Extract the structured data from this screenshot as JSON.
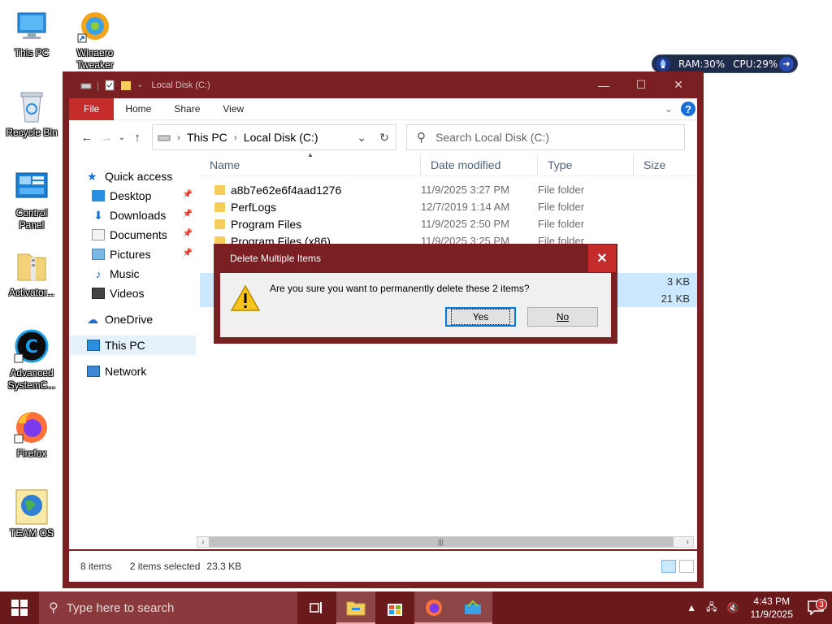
{
  "desktop": {
    "icons": [
      {
        "label": "This PC"
      },
      {
        "label": "Winaero\nTweaker"
      },
      {
        "label": "Recycle Bin"
      },
      {
        "label": "Control\nPanel"
      },
      {
        "label": "Activator..."
      },
      {
        "label": "Advanced\nSystemC..."
      },
      {
        "label": "Firefox"
      },
      {
        "label": "TEAM OS"
      }
    ]
  },
  "perf_widget": {
    "ram": "RAM:30%",
    "cpu": "CPU:29%"
  },
  "explorer": {
    "title": "Local Disk (C:)",
    "ribbon_tabs": [
      "File",
      "Home",
      "Share",
      "View"
    ],
    "address": {
      "segments": [
        "This PC",
        "Local Disk (C:)"
      ]
    },
    "search_placeholder": "Search Local Disk (C:)",
    "nav_items": [
      {
        "label": "Quick access",
        "icon": "star-icon"
      },
      {
        "label": "Desktop",
        "icon": "desktop-icon"
      },
      {
        "label": "Downloads",
        "icon": "download-icon"
      },
      {
        "label": "Documents",
        "icon": "documents-icon"
      },
      {
        "label": "Pictures",
        "icon": "pictures-icon"
      },
      {
        "label": "Music",
        "icon": "music-icon"
      },
      {
        "label": "Videos",
        "icon": "videos-icon"
      },
      {
        "label": "OneDrive",
        "icon": "cloud-icon"
      },
      {
        "label": "This PC",
        "icon": "computer-icon"
      },
      {
        "label": "Network",
        "icon": "network-icon"
      }
    ],
    "columns": [
      "Name",
      "Date modified",
      "Type",
      "Size"
    ],
    "rows": [
      {
        "name": "a8b7e62e6f4aad1276",
        "date": "11/9/2025 3:27 PM",
        "type": "File folder",
        "size": ""
      },
      {
        "name": "PerfLogs",
        "date": "12/7/2019 1:14 AM",
        "type": "File folder",
        "size": ""
      },
      {
        "name": "Program Files",
        "date": "11/9/2025 2:50 PM",
        "type": "File folder",
        "size": ""
      },
      {
        "name": "Program Files (x86)",
        "date": "11/9/2025 3:25 PM",
        "type": "File folder",
        "size": ""
      }
    ],
    "hidden_rows_sizes": [
      "3 KB",
      "21 KB"
    ],
    "status": {
      "count": "8 items",
      "selected": "2 items selected",
      "size": "23.3 KB"
    }
  },
  "dialog": {
    "title": "Delete Multiple Items",
    "message": "Are you sure you want to permanently delete these 2 items?",
    "yes": "Yes",
    "no": "No"
  },
  "taskbar": {
    "search_placeholder": "Type here to search",
    "time": "4:43 PM",
    "date": "11/9/2025",
    "notification_count": "3"
  }
}
